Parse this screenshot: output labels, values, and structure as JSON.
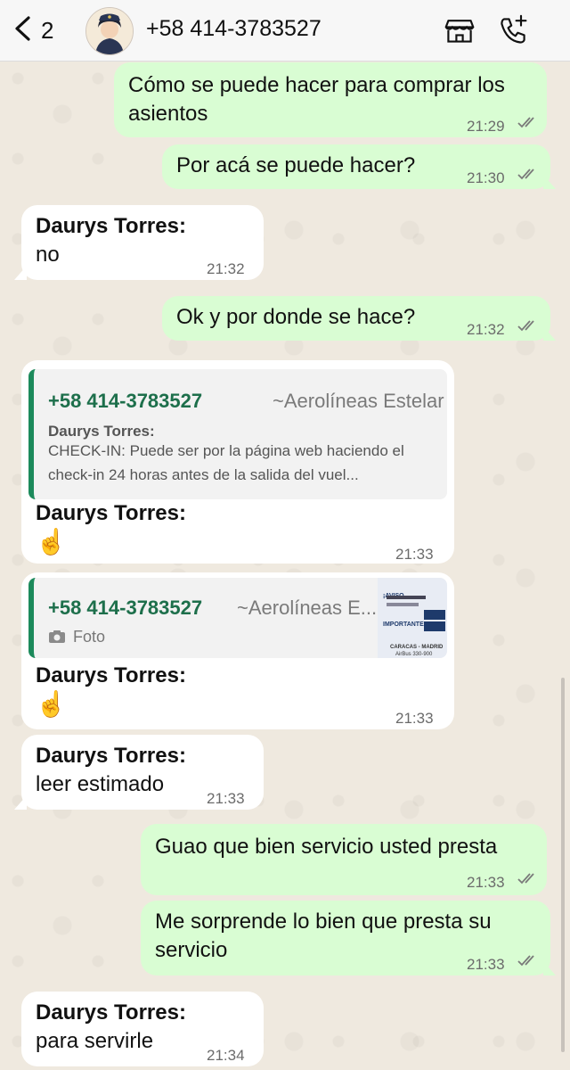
{
  "header": {
    "back_count": "2",
    "contact_name": "+58 414-3783527"
  },
  "messages": [
    {
      "text": "Cómo se puede hacer para comprar los asientos",
      "time": "21:29"
    },
    {
      "text": "Por acá se puede hacer?",
      "time": "21:30"
    },
    {
      "sender": "Daurys Torres:",
      "text": "no",
      "time": "21:32"
    },
    {
      "text": "Ok y por donde se hace?",
      "time": "21:32"
    },
    {
      "quote": {
        "phone": "+58 414-3783527",
        "group": "~Aerolíneas Estelar",
        "sender": "Daurys Torres:",
        "body": "CHECK-IN: Puede ser por la página web haciendo el check-in 24 horas antes de la salida del vuel..."
      },
      "sender": "Daurys Torres:",
      "text": "☝️",
      "time": "21:33"
    },
    {
      "quote": {
        "phone": "+58 414-3783527",
        "group": "~Aerolíneas E...",
        "media_label": "Foto",
        "thumb_title": "¡AVISO IMPORTANTE!",
        "thumb_line1": "CARACAS - MADRID",
        "thumb_line2": "AirBus 330-900"
      },
      "sender": "Daurys Torres:",
      "text": "☝️",
      "time": "21:33"
    },
    {
      "sender": "Daurys Torres:",
      "text": "leer estimado",
      "time": "21:33"
    },
    {
      "text": "Guao que bien servicio usted presta",
      "time": "21:33"
    },
    {
      "text": "Me sorprende lo bien que presta su servicio",
      "time": "21:33"
    },
    {
      "sender": "Daurys Torres:",
      "text": "para servirle",
      "time": "21:34"
    }
  ],
  "colors": {
    "outgoing_bubble": "#d9fdd3",
    "incoming_bubble": "#ffffff",
    "quote_accent": "#1c8a5b",
    "read_ticks": "#7a7a7a"
  }
}
